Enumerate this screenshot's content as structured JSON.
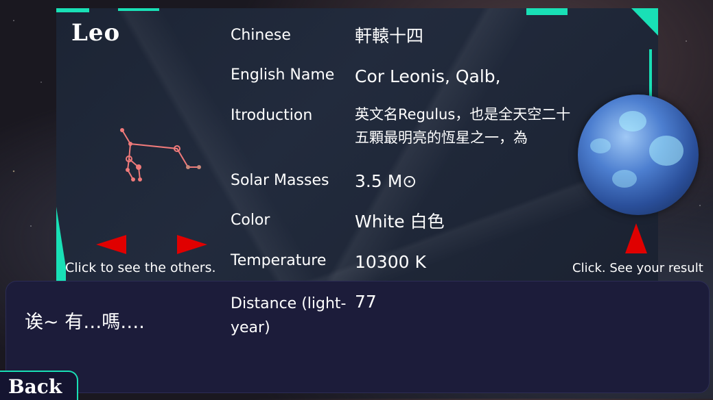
{
  "constellation": {
    "name": "Leo"
  },
  "rows": [
    {
      "label": "Chinese",
      "value": "軒轅十四"
    },
    {
      "label": "English Name",
      "value": "Cor Leonis, Qalb,"
    },
    {
      "label": "Itroduction",
      "value": "英文名Regulus，也是全天空二十五顆最明亮的恆星之一，為"
    },
    {
      "label": "Solar Masses",
      "value": "3.5 M⊙"
    },
    {
      "label": "Color",
      "value": "White 白色"
    },
    {
      "label": "Temperature",
      "value": "10300 K"
    },
    {
      "label": "Distance (light-year)",
      "value": "77"
    }
  ],
  "hints": {
    "others": "Click to see the others.",
    "result": "Click. See your result"
  },
  "dialog": {
    "text": "诶~ 有…嗎…."
  },
  "back_label": "Back",
  "colors": {
    "accent": "#19e0b6",
    "arrow": "#e00000",
    "star_line": "#f07a7a"
  },
  "icons": [
    "arrow-left-icon",
    "arrow-right-icon",
    "arrow-up-icon",
    "globe-icon",
    "constellation-icon"
  ]
}
